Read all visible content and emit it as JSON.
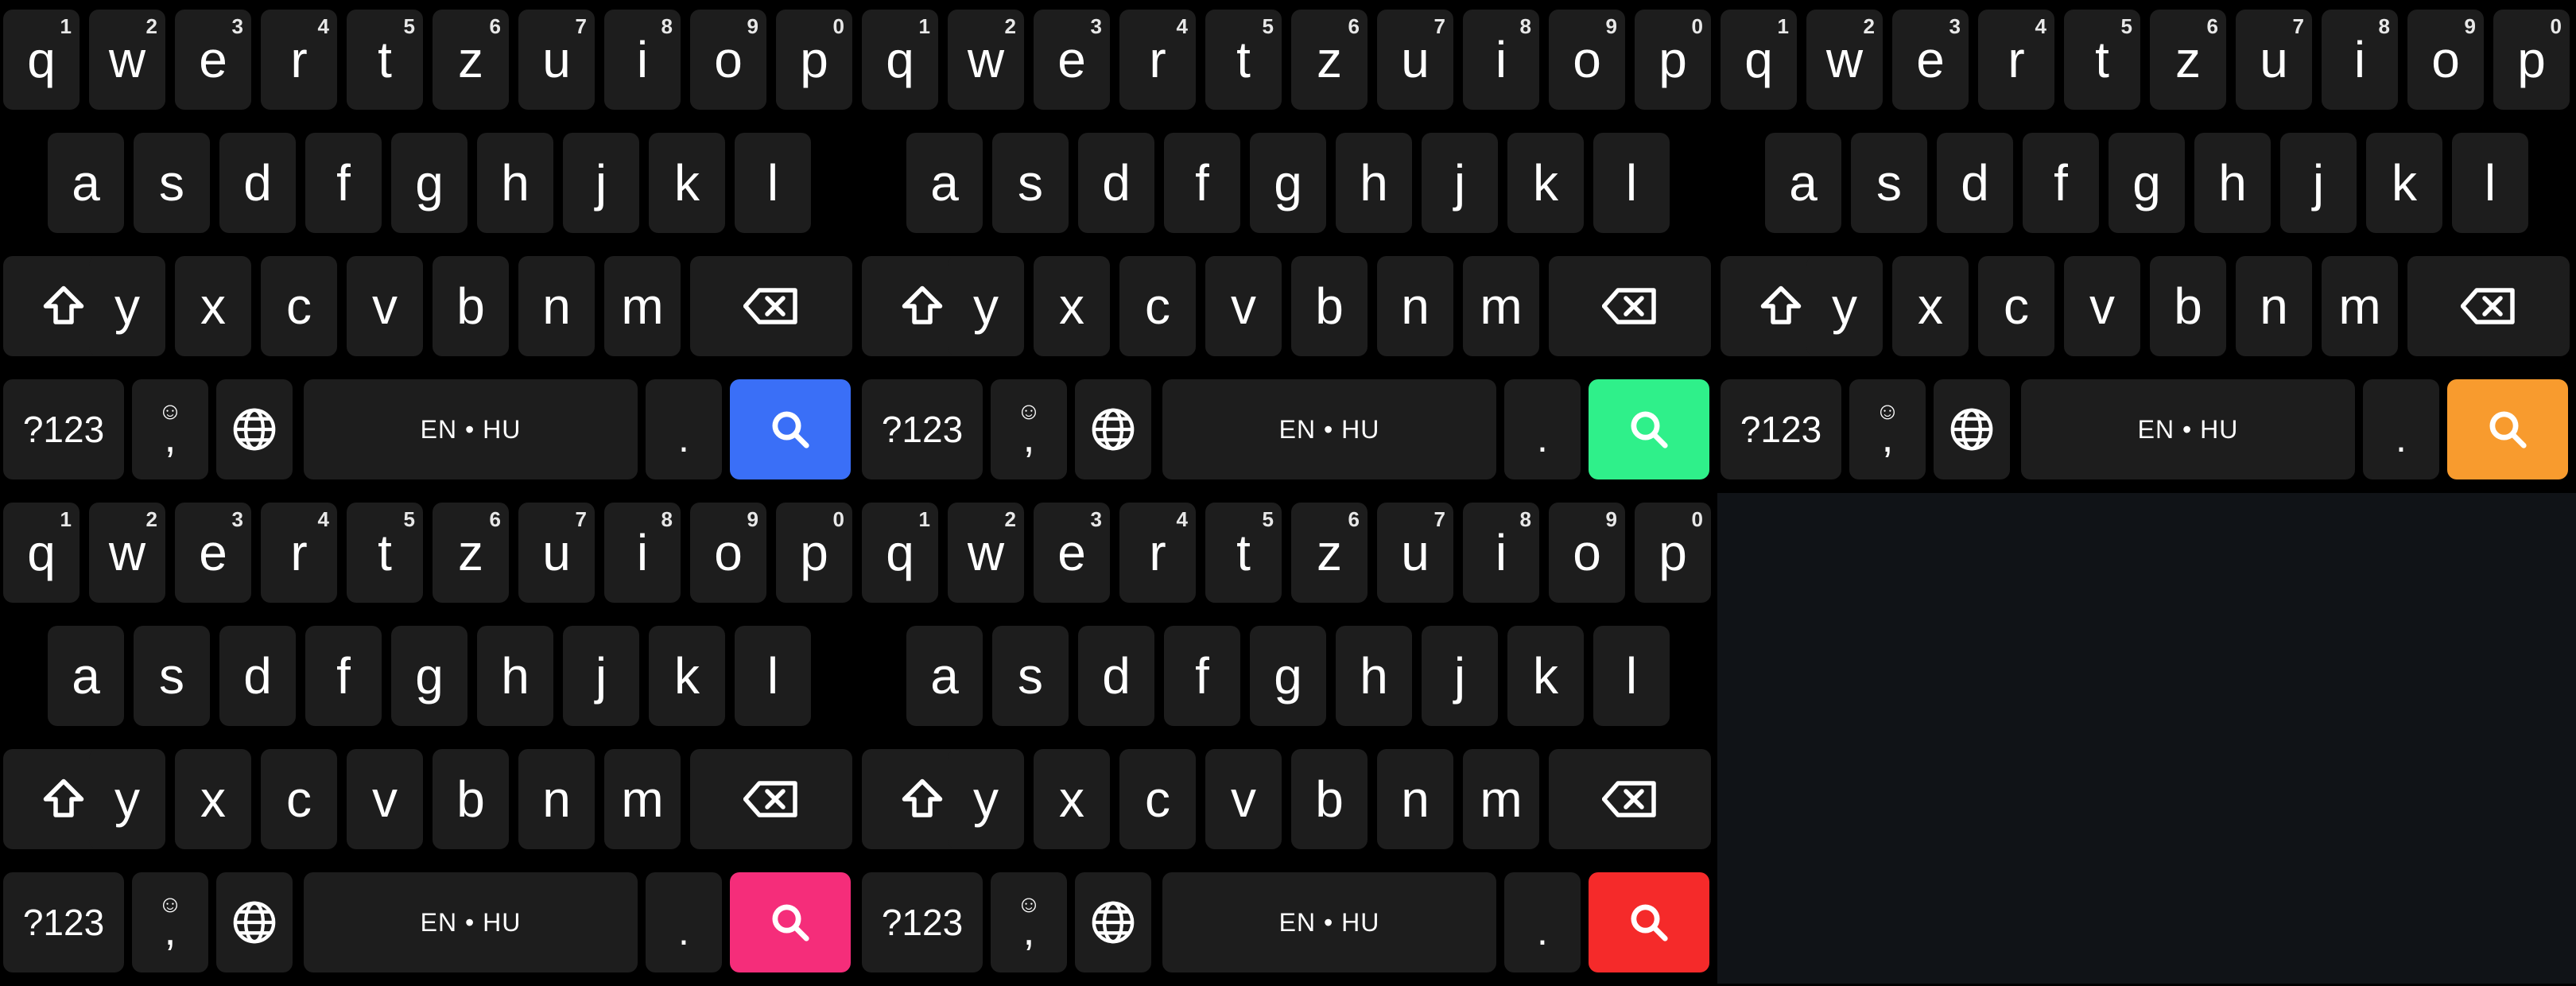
{
  "keyboard": {
    "row1": [
      {
        "label": "q",
        "hint": "1"
      },
      {
        "label": "w",
        "hint": "2"
      },
      {
        "label": "e",
        "hint": "3"
      },
      {
        "label": "r",
        "hint": "4"
      },
      {
        "label": "t",
        "hint": "5"
      },
      {
        "label": "z",
        "hint": "6"
      },
      {
        "label": "u",
        "hint": "7"
      },
      {
        "label": "i",
        "hint": "8"
      },
      {
        "label": "o",
        "hint": "9"
      },
      {
        "label": "p",
        "hint": "0"
      }
    ],
    "row2": [
      "a",
      "s",
      "d",
      "f",
      "g",
      "h",
      "j",
      "k",
      "l"
    ],
    "row3": [
      "y",
      "x",
      "c",
      "v",
      "b",
      "n",
      "m"
    ],
    "symbols_label": "?123",
    "emoji_glyph": "☺",
    "comma_label": ",",
    "space_label": "EN • HU",
    "period_label": ".",
    "icons": {
      "shift": "shift-icon",
      "backspace": "backspace-icon",
      "language": "globe-icon",
      "action": "search-icon"
    }
  },
  "variants": [
    {
      "action_color": "#3a6ff7"
    },
    {
      "action_color": "#2ff08a"
    },
    {
      "action_color": "#f89b2e"
    },
    {
      "action_color": "#f52d7a"
    },
    {
      "action_color": "#f52a2a"
    }
  ],
  "empty_panel_color": "#101317"
}
